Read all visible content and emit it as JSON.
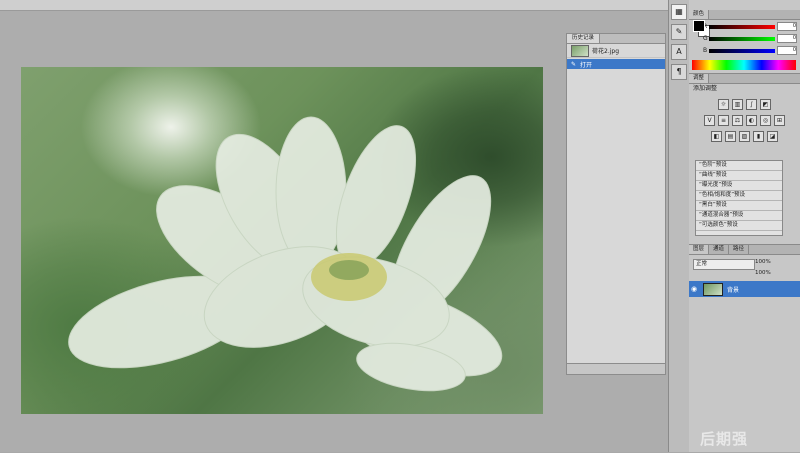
{
  "history_panel": {
    "tabs": [
      "历史记录"
    ],
    "snapshot_name": "荷花2.jpg",
    "steps": [
      "打开"
    ]
  },
  "tool_icons": [
    "swatches-icon",
    "brush-icon",
    "type-icon",
    "paragraph-icon"
  ],
  "color_panel": {
    "tabs": [
      "颜色"
    ],
    "channels": [
      {
        "letter": "R",
        "value": "0"
      },
      {
        "letter": "G",
        "value": "0"
      },
      {
        "letter": "B",
        "value": "0"
      }
    ]
  },
  "adjustments_panel": {
    "tabs": [
      "调整"
    ],
    "title": "添加调整",
    "presets": [
      "“色阶”预设",
      "“曲线”预设",
      "“曝光度”预设",
      "“色相/饱和度”预设",
      "“黑白”预设",
      "“通道混合器”预设",
      "“可选颜色”预设"
    ]
  },
  "layers_panel": {
    "tabs": [
      "图层",
      "通道",
      "路径"
    ],
    "blend_mode": "正常",
    "opacity": "100%",
    "fill": "100%",
    "layer_name": "背景"
  },
  "watermark": "后期强"
}
